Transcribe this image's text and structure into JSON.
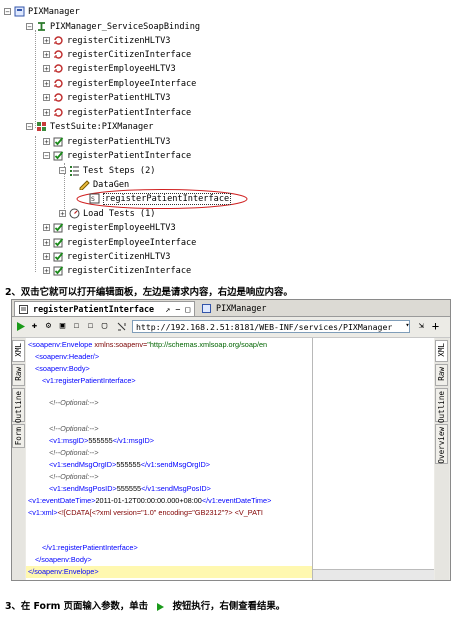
{
  "tree": {
    "root": "PIXManager",
    "binding": "PIXManager_ServiceSoapBinding",
    "binding_ops": [
      "registerCitizenHLTV3",
      "registerCitizenInterface",
      "registerEmployeeHLTV3",
      "registerEmployeeInterface",
      "registerPatientHLTV3",
      "registerPatientInterface"
    ],
    "suite": "TestSuite:PIXManager",
    "case1": "registerPatientHLTV3",
    "case2": "registerPatientInterface",
    "steps": "Test Steps (2)",
    "step1": "DataGen",
    "step2": "registerPatientInterface",
    "load": "Load Tests (1)",
    "cases_after": [
      "registerEmployeeHLTV3",
      "registerEmployeeInterface",
      "registerCitizenHLTV3",
      "registerCitizenInterface"
    ]
  },
  "caption2": "2、双击它就可以打开编辑面板，左边是请求内容，右边是响应内容。",
  "editor_panel": {
    "tab_active": "registerPatientInterface",
    "tab_icons": "↗ − □",
    "tab_other": "PIXManager",
    "url": "http://192.168.2.51:8181/WEB-INF/services/PIXManager",
    "left_tabs": [
      "XML",
      "Raw",
      "Outline",
      "Form"
    ],
    "right_tabs": [
      "XML",
      "Raw",
      "Outline",
      "Overview"
    ],
    "xml_lines": [
      {
        "t": "<soapenv:Envelope ",
        "a": "xmlns:soapenv=",
        "v": "\"http://schemas.xmlsoap.org/soap/en"
      },
      {
        "t": "<soapenv:Header/>"
      },
      {
        "t": "<soapenv:Body>"
      },
      {
        "t": "<v1:registerPatientInterface>"
      },
      {
        "c": "<!--Optional:-->"
      },
      {
        "c": "<!--Optional:-->"
      },
      {
        "t1": "<v1:msgID>",
        "x": "555555",
        "t2": "</v1:msgID>"
      },
      {
        "c": "<!--Optional:-->"
      },
      {
        "t1": "<v1:sendMsgOrgID>",
        "x": "555555",
        "t2": "</v1:sendMsgOrgID>"
      },
      {
        "c": "<!--Optional:-->"
      },
      {
        "t1": "<v1:sendMsgPosID>",
        "x": "555555",
        "t2": "</v1:sendMsgPosID>"
      },
      {
        "t1": "<v1:eventDateTime>",
        "x": "2011-01-12T00:00:00.000+08:00",
        "t2": "</v1:eventDateTime>"
      },
      {
        "t1": "<v1:xml>",
        "x": "<![CDATA[<?xml version=\"1.0\" encoding=\"GB2312\"?>  <V_PATI"
      },
      {
        "t": "</v1:registerPatientInterface>"
      },
      {
        "t": "</soapenv:Body>"
      },
      {
        "t": "</soapenv:Envelope>"
      }
    ]
  },
  "caption3_a": "3、在 Form 页面输入参数，单击",
  "caption3_b": "按钮执行，右侧查看结果。"
}
